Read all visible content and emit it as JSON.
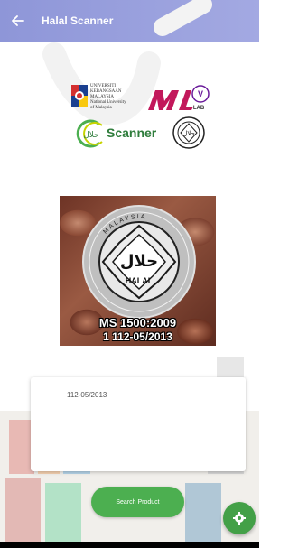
{
  "app_bar": {
    "title": "Halal Scanner",
    "color": "#8e96d8"
  },
  "logos": {
    "ukm_text": [
      "UNIVERSITI",
      "KEBANGSAAN",
      "MALAYSIA",
      "National University",
      "of Malaysia"
    ],
    "mlv": "MLV",
    "mlv_sub": "LAB",
    "scanner_label": "Scanner"
  },
  "scan_image": {
    "certification": "MS 1500:2009",
    "number": "1 112-05/2013",
    "halal_word": "HALAL",
    "country_arc": "MALAYSIA"
  },
  "result": {
    "text": "112-05/2013"
  },
  "search_button": {
    "label": "Search Product",
    "color": "#4caf50"
  },
  "fab": {
    "icon": "gear-icon",
    "color": "#43a047"
  }
}
